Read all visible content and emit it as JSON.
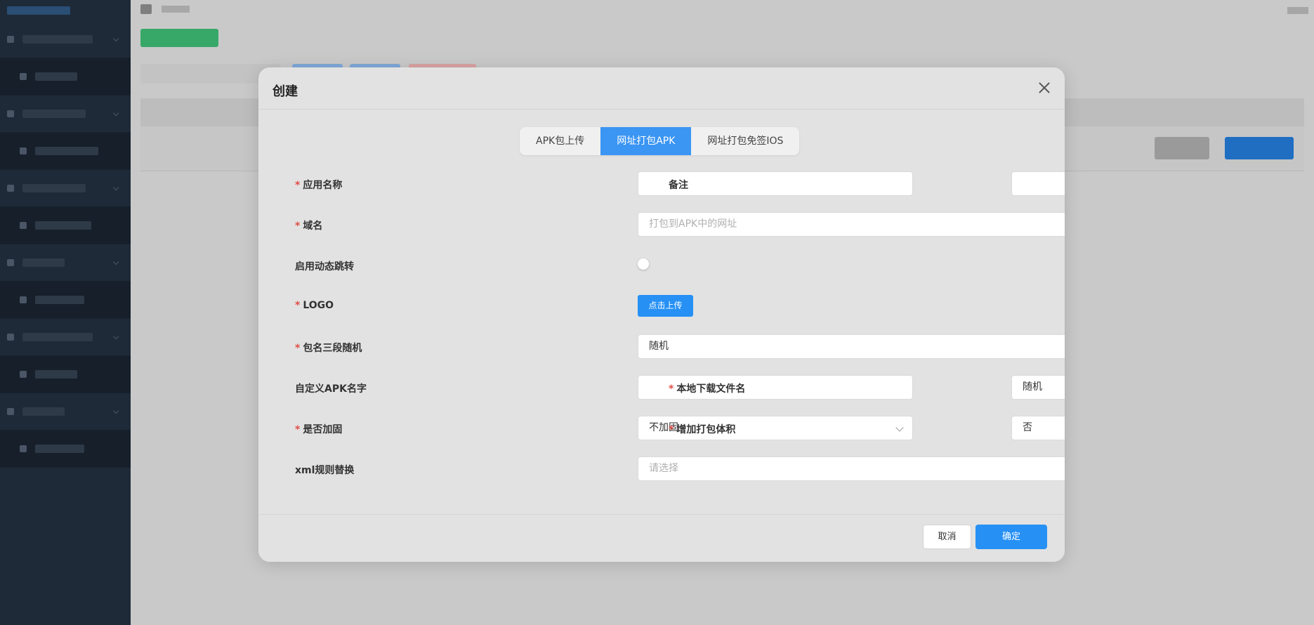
{
  "modal": {
    "title": "创建",
    "tabs": [
      {
        "label": "APK包上传",
        "active": false
      },
      {
        "label": "网址打包APK",
        "active": true
      },
      {
        "label": "网址打包免签IOS",
        "active": false
      }
    ],
    "fields": {
      "app_name": {
        "label": "应用名称",
        "required": true,
        "value": ""
      },
      "remark": {
        "label": "备注",
        "required": false,
        "value": ""
      },
      "domain": {
        "label": "域名",
        "required": true,
        "placeholder": "打包到APK中的网址",
        "value": ""
      },
      "dynamic_redirect": {
        "label": "启用动态跳转",
        "required": false,
        "enabled": false
      },
      "logo": {
        "label": "LOGO",
        "required": true,
        "button_label": "点击上传"
      },
      "package_random": {
        "label": "包名三段随机",
        "required": true,
        "value": "随机"
      },
      "custom_apk_name": {
        "label": "自定义APK名字",
        "required": false,
        "value": ""
      },
      "local_filename": {
        "label": "本地下载文件名",
        "required": true,
        "value": "随机"
      },
      "hardening": {
        "label": "是否加固",
        "required": true,
        "value": "不加固"
      },
      "increase_size": {
        "label": "增加打包体积",
        "required": true,
        "value": "否"
      },
      "xml_rule": {
        "label": "xml规则替换",
        "required": false,
        "placeholder": "请选择",
        "value": ""
      }
    },
    "footer": {
      "cancel_label": "取消",
      "ok_label": "确定"
    }
  },
  "colors": {
    "primary": "#2690f5",
    "tab_active": "#3a95f3",
    "required": "#e04d45",
    "overlay": "#b8b8b8"
  }
}
